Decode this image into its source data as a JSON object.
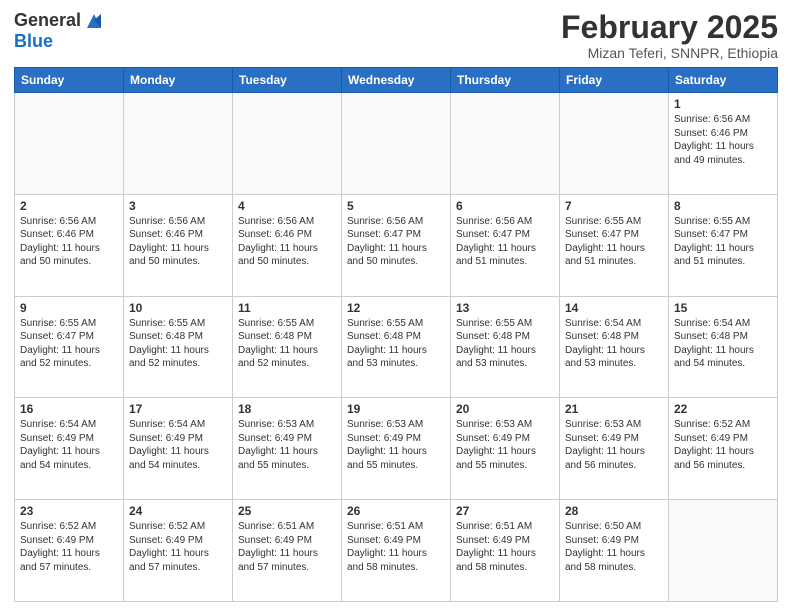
{
  "header": {
    "logo_general": "General",
    "logo_blue": "Blue",
    "title": "February 2025",
    "subtitle": "Mizan Teferi, SNNPR, Ethiopia"
  },
  "weekdays": [
    "Sunday",
    "Monday",
    "Tuesday",
    "Wednesday",
    "Thursday",
    "Friday",
    "Saturday"
  ],
  "weeks": [
    [
      {
        "day": "",
        "sunrise": "",
        "sunset": "",
        "daylight": "",
        "empty": true
      },
      {
        "day": "",
        "sunrise": "",
        "sunset": "",
        "daylight": "",
        "empty": true
      },
      {
        "day": "",
        "sunrise": "",
        "sunset": "",
        "daylight": "",
        "empty": true
      },
      {
        "day": "",
        "sunrise": "",
        "sunset": "",
        "daylight": "",
        "empty": true
      },
      {
        "day": "",
        "sunrise": "",
        "sunset": "",
        "daylight": "",
        "empty": true
      },
      {
        "day": "",
        "sunrise": "",
        "sunset": "",
        "daylight": "",
        "empty": true
      },
      {
        "day": "1",
        "sunrise": "Sunrise: 6:56 AM",
        "sunset": "Sunset: 6:46 PM",
        "daylight": "Daylight: 11 hours and 49 minutes.",
        "empty": false
      }
    ],
    [
      {
        "day": "2",
        "sunrise": "Sunrise: 6:56 AM",
        "sunset": "Sunset: 6:46 PM",
        "daylight": "Daylight: 11 hours and 50 minutes.",
        "empty": false
      },
      {
        "day": "3",
        "sunrise": "Sunrise: 6:56 AM",
        "sunset": "Sunset: 6:46 PM",
        "daylight": "Daylight: 11 hours and 50 minutes.",
        "empty": false
      },
      {
        "day": "4",
        "sunrise": "Sunrise: 6:56 AM",
        "sunset": "Sunset: 6:46 PM",
        "daylight": "Daylight: 11 hours and 50 minutes.",
        "empty": false
      },
      {
        "day": "5",
        "sunrise": "Sunrise: 6:56 AM",
        "sunset": "Sunset: 6:47 PM",
        "daylight": "Daylight: 11 hours and 50 minutes.",
        "empty": false
      },
      {
        "day": "6",
        "sunrise": "Sunrise: 6:56 AM",
        "sunset": "Sunset: 6:47 PM",
        "daylight": "Daylight: 11 hours and 51 minutes.",
        "empty": false
      },
      {
        "day": "7",
        "sunrise": "Sunrise: 6:55 AM",
        "sunset": "Sunset: 6:47 PM",
        "daylight": "Daylight: 11 hours and 51 minutes.",
        "empty": false
      },
      {
        "day": "8",
        "sunrise": "Sunrise: 6:55 AM",
        "sunset": "Sunset: 6:47 PM",
        "daylight": "Daylight: 11 hours and 51 minutes.",
        "empty": false
      }
    ],
    [
      {
        "day": "9",
        "sunrise": "Sunrise: 6:55 AM",
        "sunset": "Sunset: 6:47 PM",
        "daylight": "Daylight: 11 hours and 52 minutes.",
        "empty": false
      },
      {
        "day": "10",
        "sunrise": "Sunrise: 6:55 AM",
        "sunset": "Sunset: 6:48 PM",
        "daylight": "Daylight: 11 hours and 52 minutes.",
        "empty": false
      },
      {
        "day": "11",
        "sunrise": "Sunrise: 6:55 AM",
        "sunset": "Sunset: 6:48 PM",
        "daylight": "Daylight: 11 hours and 52 minutes.",
        "empty": false
      },
      {
        "day": "12",
        "sunrise": "Sunrise: 6:55 AM",
        "sunset": "Sunset: 6:48 PM",
        "daylight": "Daylight: 11 hours and 53 minutes.",
        "empty": false
      },
      {
        "day": "13",
        "sunrise": "Sunrise: 6:55 AM",
        "sunset": "Sunset: 6:48 PM",
        "daylight": "Daylight: 11 hours and 53 minutes.",
        "empty": false
      },
      {
        "day": "14",
        "sunrise": "Sunrise: 6:54 AM",
        "sunset": "Sunset: 6:48 PM",
        "daylight": "Daylight: 11 hours and 53 minutes.",
        "empty": false
      },
      {
        "day": "15",
        "sunrise": "Sunrise: 6:54 AM",
        "sunset": "Sunset: 6:48 PM",
        "daylight": "Daylight: 11 hours and 54 minutes.",
        "empty": false
      }
    ],
    [
      {
        "day": "16",
        "sunrise": "Sunrise: 6:54 AM",
        "sunset": "Sunset: 6:49 PM",
        "daylight": "Daylight: 11 hours and 54 minutes.",
        "empty": false
      },
      {
        "day": "17",
        "sunrise": "Sunrise: 6:54 AM",
        "sunset": "Sunset: 6:49 PM",
        "daylight": "Daylight: 11 hours and 54 minutes.",
        "empty": false
      },
      {
        "day": "18",
        "sunrise": "Sunrise: 6:53 AM",
        "sunset": "Sunset: 6:49 PM",
        "daylight": "Daylight: 11 hours and 55 minutes.",
        "empty": false
      },
      {
        "day": "19",
        "sunrise": "Sunrise: 6:53 AM",
        "sunset": "Sunset: 6:49 PM",
        "daylight": "Daylight: 11 hours and 55 minutes.",
        "empty": false
      },
      {
        "day": "20",
        "sunrise": "Sunrise: 6:53 AM",
        "sunset": "Sunset: 6:49 PM",
        "daylight": "Daylight: 11 hours and 55 minutes.",
        "empty": false
      },
      {
        "day": "21",
        "sunrise": "Sunrise: 6:53 AM",
        "sunset": "Sunset: 6:49 PM",
        "daylight": "Daylight: 11 hours and 56 minutes.",
        "empty": false
      },
      {
        "day": "22",
        "sunrise": "Sunrise: 6:52 AM",
        "sunset": "Sunset: 6:49 PM",
        "daylight": "Daylight: 11 hours and 56 minutes.",
        "empty": false
      }
    ],
    [
      {
        "day": "23",
        "sunrise": "Sunrise: 6:52 AM",
        "sunset": "Sunset: 6:49 PM",
        "daylight": "Daylight: 11 hours and 57 minutes.",
        "empty": false
      },
      {
        "day": "24",
        "sunrise": "Sunrise: 6:52 AM",
        "sunset": "Sunset: 6:49 PM",
        "daylight": "Daylight: 11 hours and 57 minutes.",
        "empty": false
      },
      {
        "day": "25",
        "sunrise": "Sunrise: 6:51 AM",
        "sunset": "Sunset: 6:49 PM",
        "daylight": "Daylight: 11 hours and 57 minutes.",
        "empty": false
      },
      {
        "day": "26",
        "sunrise": "Sunrise: 6:51 AM",
        "sunset": "Sunset: 6:49 PM",
        "daylight": "Daylight: 11 hours and 58 minutes.",
        "empty": false
      },
      {
        "day": "27",
        "sunrise": "Sunrise: 6:51 AM",
        "sunset": "Sunset: 6:49 PM",
        "daylight": "Daylight: 11 hours and 58 minutes.",
        "empty": false
      },
      {
        "day": "28",
        "sunrise": "Sunrise: 6:50 AM",
        "sunset": "Sunset: 6:49 PM",
        "daylight": "Daylight: 11 hours and 58 minutes.",
        "empty": false
      },
      {
        "day": "",
        "sunrise": "",
        "sunset": "",
        "daylight": "",
        "empty": true
      }
    ]
  ]
}
